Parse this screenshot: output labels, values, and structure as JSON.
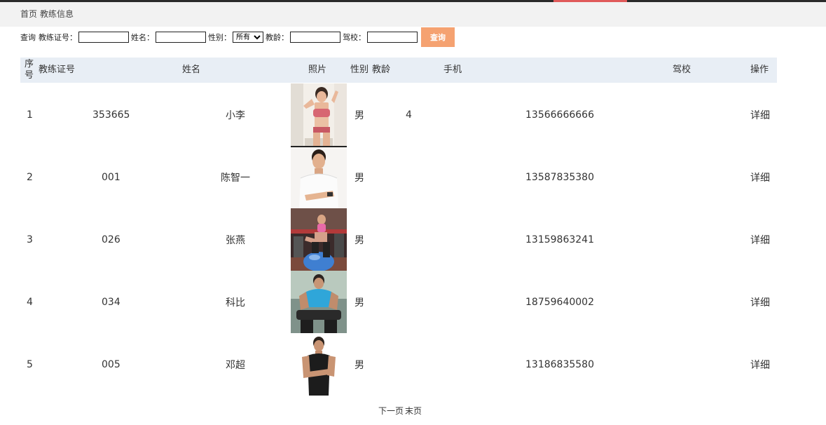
{
  "breadcrumb": {
    "home": "首页",
    "current": "教练信息"
  },
  "search": {
    "query_label": "查询",
    "coach_id_label": "教练证号：",
    "name_label": "姓名：",
    "gender_label": "性别：",
    "gender_selected": "所有",
    "age_label": "教龄：",
    "school_label": "驾校：",
    "button": "查询"
  },
  "table": {
    "headers": {
      "index": "序号",
      "coach_id": "教练证号",
      "name": "姓名",
      "photo": "照片",
      "gender": "性别",
      "age": "教龄",
      "phone": "手机",
      "school": "驾校",
      "action": "操作"
    },
    "rows": [
      {
        "index": "1",
        "coach_id": "353665",
        "name": "小李",
        "gender": "男",
        "age": "4",
        "phone": "13566666666",
        "school": "",
        "action": "详细"
      },
      {
        "index": "2",
        "coach_id": "001",
        "name": "陈智一",
        "gender": "男",
        "age": "",
        "phone": "13587835380",
        "school": "",
        "action": "详细"
      },
      {
        "index": "3",
        "coach_id": "026",
        "name": "张燕",
        "gender": "男",
        "age": "",
        "phone": "13159863241",
        "school": "",
        "action": "详细"
      },
      {
        "index": "4",
        "coach_id": "034",
        "name": "科比",
        "gender": "男",
        "age": "",
        "phone": "18759640002",
        "school": "",
        "action": "详细"
      },
      {
        "index": "5",
        "coach_id": "005",
        "name": "邓超",
        "gender": "男",
        "age": "",
        "phone": "13186835580",
        "school": "",
        "action": "详细"
      }
    ]
  },
  "pager": {
    "next": "下一页",
    "last": "末页"
  },
  "colors": {
    "header_bg": "#e8eef5",
    "button": "#f5a271",
    "breadcrumb_bg": "#f2f2f2"
  }
}
